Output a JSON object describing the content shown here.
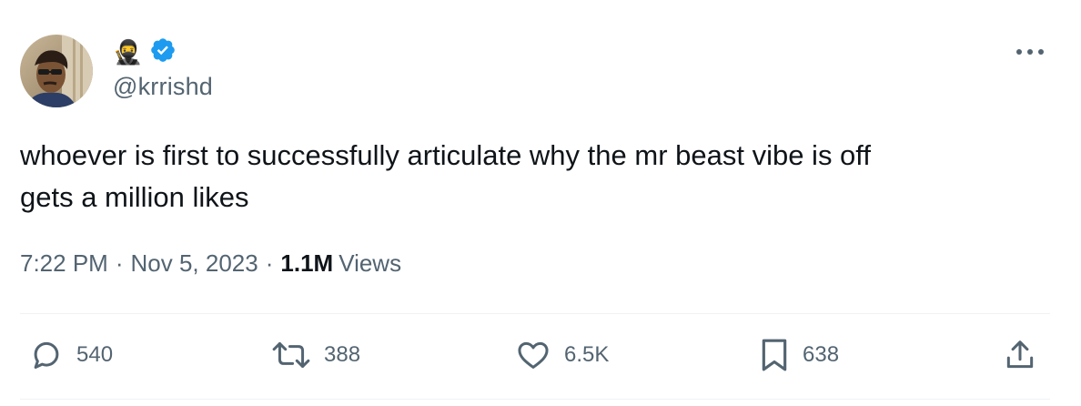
{
  "author": {
    "emoji": "🥷",
    "handle": "@krrishd",
    "verified": true,
    "verified_color": "#1d9bf0"
  },
  "tweet": {
    "lines": [
      "whoever is first to successfully articulate why the mr beast vibe is off",
      "gets a million likes"
    ],
    "time": "7:22 PM",
    "separator": "·",
    "date": "Nov 5, 2023",
    "views_count": "1.1M",
    "views_label": "Views"
  },
  "actions": {
    "reply_count": "540",
    "retweet_count": "388",
    "like_count": "6.5K",
    "bookmark_count": "638"
  },
  "colors": {
    "text": "#0f1419",
    "secondary": "#536471",
    "divider": "#eff3f4"
  }
}
